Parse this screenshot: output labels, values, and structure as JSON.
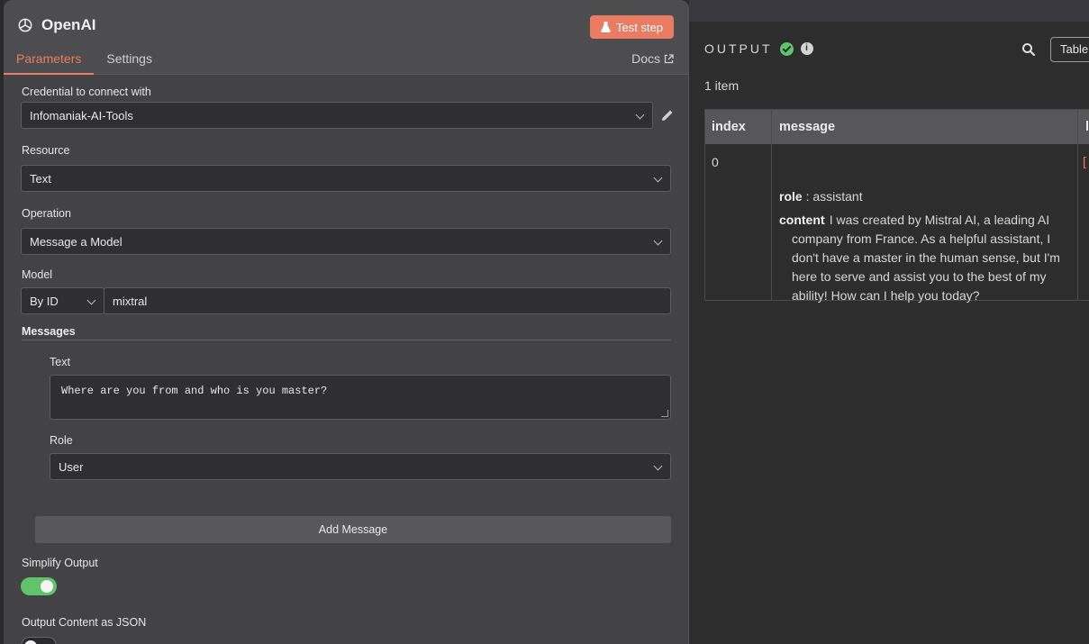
{
  "node": {
    "title": "OpenAI",
    "test_button": "Test step",
    "tabs": [
      "Parameters",
      "Settings"
    ],
    "docs_label": "Docs"
  },
  "form": {
    "credential_label": "Credential to connect with",
    "credential_value": "Infomaniak-AI-Tools",
    "resource_label": "Resource",
    "resource_value": "Text",
    "operation_label": "Operation",
    "operation_value": "Message a Model",
    "model_label": "Model",
    "model_mode": "By ID",
    "model_value": "mixtral",
    "messages_label": "Messages",
    "text_label": "Text",
    "text_value": "Where are you from and who is you master?",
    "role_label": "Role",
    "role_value": "User",
    "add_message": "Add Message",
    "simplify_label": "Simplify Output",
    "simplify_on": true,
    "json_label": "Output Content as JSON",
    "json_on": false
  },
  "output": {
    "title": "OUTPUT",
    "info": "i",
    "view_mode": "Table",
    "item_count": "1 item",
    "columns": [
      "index",
      "message",
      "l"
    ],
    "row": {
      "index": "0",
      "role_key": "role",
      "role_value": ": assistant",
      "content_key": "content",
      "content_value": ": I was created by Mistral AI, a leading AI company from France. As a helpful assistant, I don't have a master in the human sense, but I'm here to serve and assist you to the best of my ability! How can I help you today?",
      "truncated": "["
    }
  },
  "colors": {
    "accent": "#e97c62",
    "success": "#5fc46a",
    "panel": "#434345",
    "background": "#2d2d2e"
  }
}
